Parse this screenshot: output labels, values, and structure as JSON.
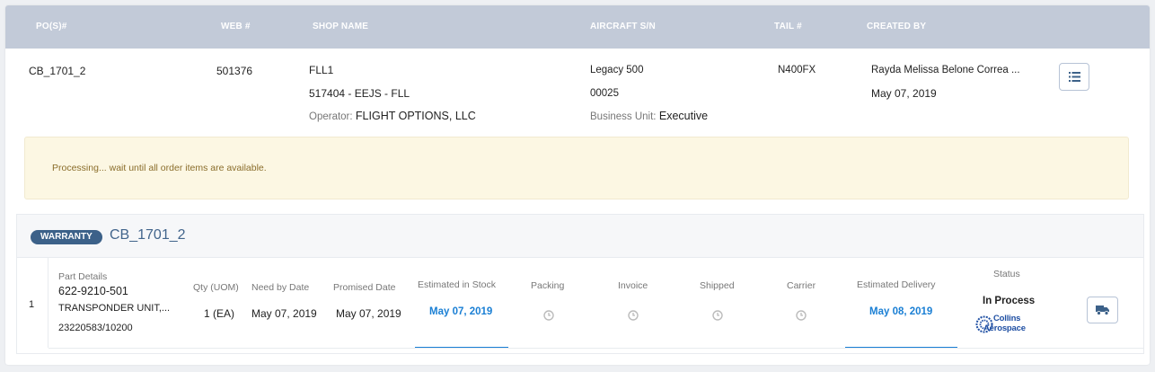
{
  "header": {
    "pos": "PO(S)#",
    "web": "WEB #",
    "shop_name": "SHOP NAME",
    "aircraft_sn": "AIRCRAFT S/N",
    "tail": "TAIL #",
    "created_by": "CREATED BY"
  },
  "record": {
    "po": "CB_1701_2",
    "web": "501376",
    "shop_name": "FLL1",
    "shop_code": "517404 - EEJS - FLL",
    "operator_label": "Operator:",
    "operator_value": "FLIGHT OPTIONS, LLC",
    "aircraft_model": "Legacy 500",
    "aircraft_sn": "00025",
    "business_unit_label": "Business Unit:",
    "business_unit_value": "Executive",
    "tail": "N400FX",
    "created_by": "Rayda Melissa Belone Correa ...",
    "created_date": "May 07, 2019",
    "list_icon": "list-icon"
  },
  "alert": {
    "message": "Processing... wait until all order items are available."
  },
  "order": {
    "badge": "WARRANTY",
    "number": "CB_1701_2",
    "columns": {
      "part_details": "Part Details",
      "qty": "Qty (UOM)",
      "need_by": "Need by Date",
      "promised": "Promised Date",
      "est_stock": "Estimated in Stock",
      "packing": "Packing",
      "invoice": "Invoice",
      "shipped": "Shipped",
      "carrier": "Carrier",
      "est_delivery": "Estimated Delivery",
      "status": "Status"
    },
    "line": {
      "number": "1",
      "part_number": "622-9210-501",
      "description": "TRANSPONDER UNIT,...",
      "serial": "23220583/10200",
      "qty": "1 (EA)",
      "need_by": "May 07, 2019",
      "promised": "May 07, 2019",
      "est_stock": "May 07, 2019",
      "est_delivery": "May 08, 2019",
      "status": "In Process",
      "vendor_logo_line1": "Collins",
      "vendor_logo_line2": "Aerospace",
      "truck_icon": "truck-icon",
      "clock_icon": "clock-icon"
    }
  },
  "colors": {
    "header_bg": "#c2cad8",
    "badge_bg": "#3c6189",
    "link_blue": "#1a7fd4",
    "alert_bg": "#fcf7e3",
    "alert_text": "#8a6d2b"
  }
}
